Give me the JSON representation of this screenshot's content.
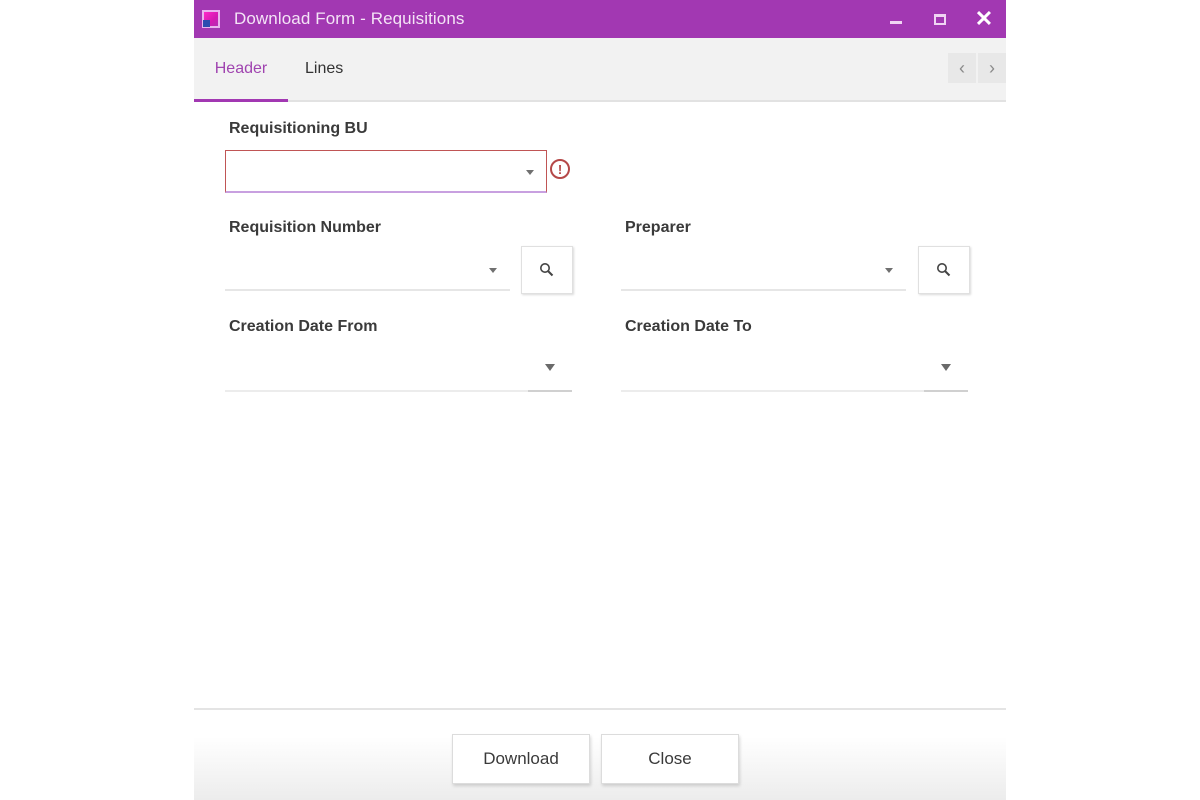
{
  "window": {
    "title": "Download Form - Requisitions",
    "icon": "app-icon",
    "controls": {
      "minimize": "minimize-icon",
      "maximize": "maximize-icon",
      "close": "close-icon",
      "close_glyph": "✕"
    },
    "accent_color": "#a238b2"
  },
  "tabs": [
    {
      "label": "Header",
      "active": true
    },
    {
      "label": "Lines",
      "active": false
    }
  ],
  "tab_nav": {
    "prev": "‹",
    "next": "›"
  },
  "form": {
    "requisitioning_bu": {
      "label": "Requisitioning BU",
      "value": "",
      "error": true,
      "error_glyph": "!"
    },
    "requisition_number": {
      "label": "Requisition Number",
      "value": ""
    },
    "preparer": {
      "label": "Preparer",
      "value": ""
    },
    "creation_date_from": {
      "label": "Creation Date From",
      "value": ""
    },
    "creation_date_to": {
      "label": "Creation Date To",
      "value": ""
    }
  },
  "footer": {
    "download_label": "Download",
    "close_label": "Close"
  }
}
